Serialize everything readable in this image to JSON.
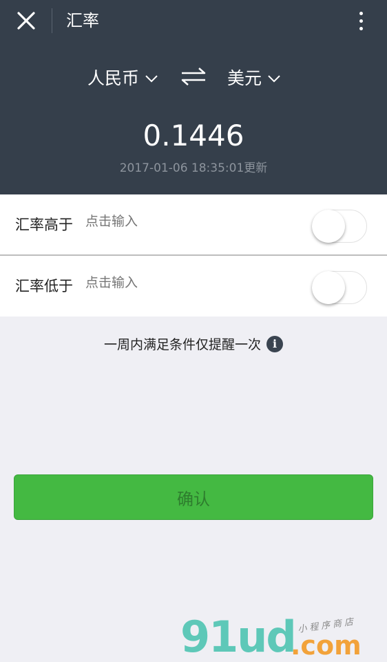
{
  "header": {
    "title": "汇率",
    "from_currency": "人民币",
    "to_currency": "美元",
    "rate": "0.1446",
    "updated": "2017-01-06 18:35:01更新"
  },
  "alerts": [
    {
      "label": "汇率高于",
      "placeholder": "点击输入",
      "enabled": false
    },
    {
      "label": "汇率低于",
      "placeholder": "点击输入",
      "enabled": false
    }
  ],
  "notice": "一周内满足条件仅提醒一次",
  "confirm_label": "确认",
  "watermark": {
    "main": "91ud",
    "domain": ".com",
    "slogan": "小程序商店"
  },
  "colors": {
    "header_bg": "#353f4b",
    "button_green": "#44b942"
  },
  "icons": [
    "close-icon",
    "more-icon",
    "chevron-down-icon",
    "swap-icon",
    "info-icon"
  ]
}
